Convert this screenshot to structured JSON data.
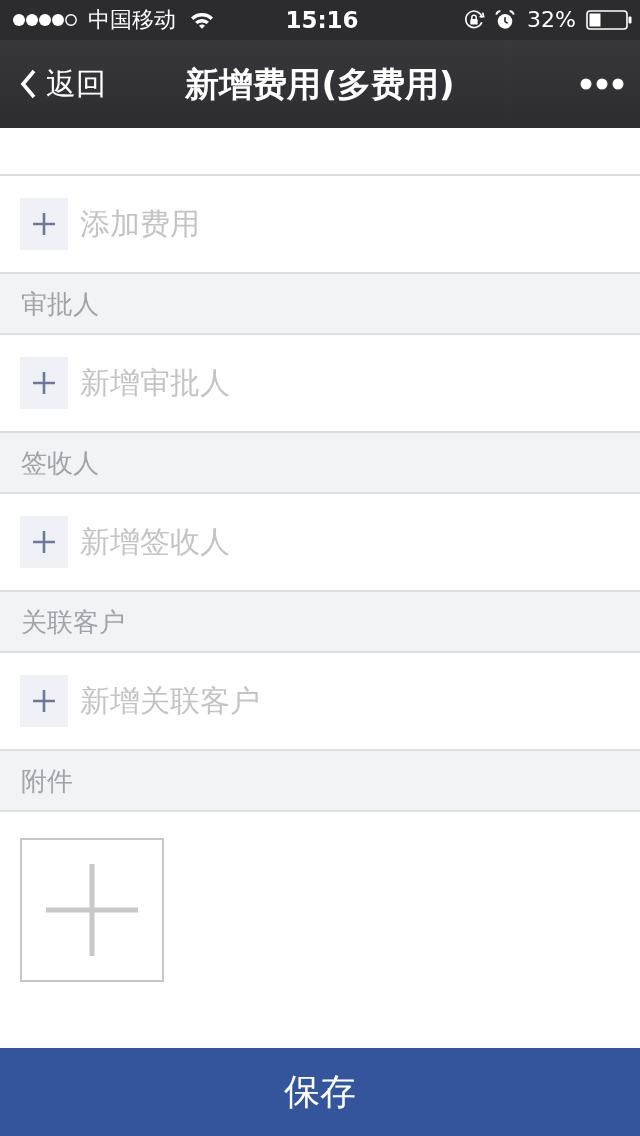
{
  "status_bar": {
    "carrier": "中国移动",
    "time": "15:16",
    "battery": "32%"
  },
  "nav_bar": {
    "back_label": "返回",
    "title": "新增费用(多费用)"
  },
  "expense": {
    "add_label": "添加费用"
  },
  "sections": [
    {
      "kind": "add",
      "title": "审批人",
      "add_label": "新增审批人"
    },
    {
      "kind": "add",
      "title": "签收人",
      "add_label": "新增签收人"
    },
    {
      "kind": "add",
      "title": "关联客户",
      "add_label": "新增关联客户"
    },
    {
      "kind": "upload",
      "title": "附件"
    }
  ],
  "save_button": "保存"
}
